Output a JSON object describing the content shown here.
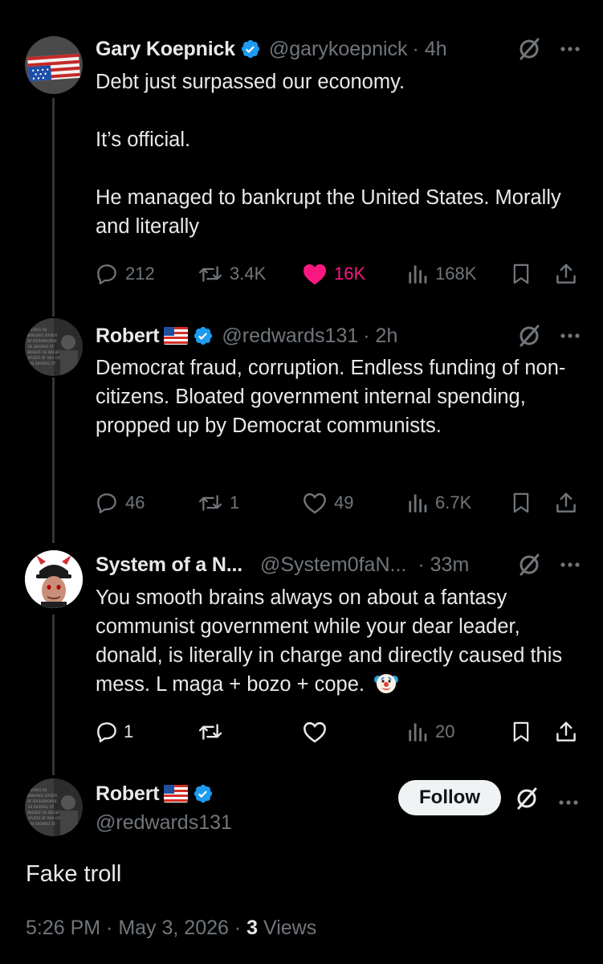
{
  "colors": {
    "background": "#000000",
    "text": "#e7e9ea",
    "muted": "#71767b",
    "verified": "#1d9bf0",
    "like": "#f91880"
  },
  "posts": [
    {
      "name": "Gary Koepnick",
      "handle": "@garykoepnick",
      "time": "· 4h",
      "text": "Debt just surpassed our economy.\n\nIt’s official.\n\nHe managed to bankrupt the United States. Morally and literally",
      "replies": "212",
      "reposts": "3.4K",
      "likes": "16K",
      "views": "168K",
      "liked": true
    },
    {
      "name": "Robert",
      "flag": "us-flag",
      "handle": "@redwards131",
      "time": "· 2h",
      "text": "Democrat fraud, corruption.  Endless funding of non-citizens. Bloated government internal spending, propped up by Democrat communists.",
      "replies": "46",
      "reposts": "1",
      "likes": "49",
      "views": "6.7K"
    },
    {
      "name": "System of a N...",
      "handle": "@System0faN...",
      "time": "· 33m",
      "text": "You smooth brains always on about a fantasy communist government while your dear leader, donald, is literally in charge and directly caused this mess. L maga + bozo + cope.",
      "emoji": "clown-face",
      "replies": "1",
      "reposts": "",
      "likes": "",
      "views": "20"
    }
  ],
  "main_post": {
    "name": "Robert",
    "flag": "us-flag",
    "handle": "@redwards131",
    "follow_label": "Follow",
    "text": "Fake troll",
    "timestamp": "5:26 PM · May 3, 2026 · ",
    "views_count": "3",
    "views_label": " Views"
  }
}
